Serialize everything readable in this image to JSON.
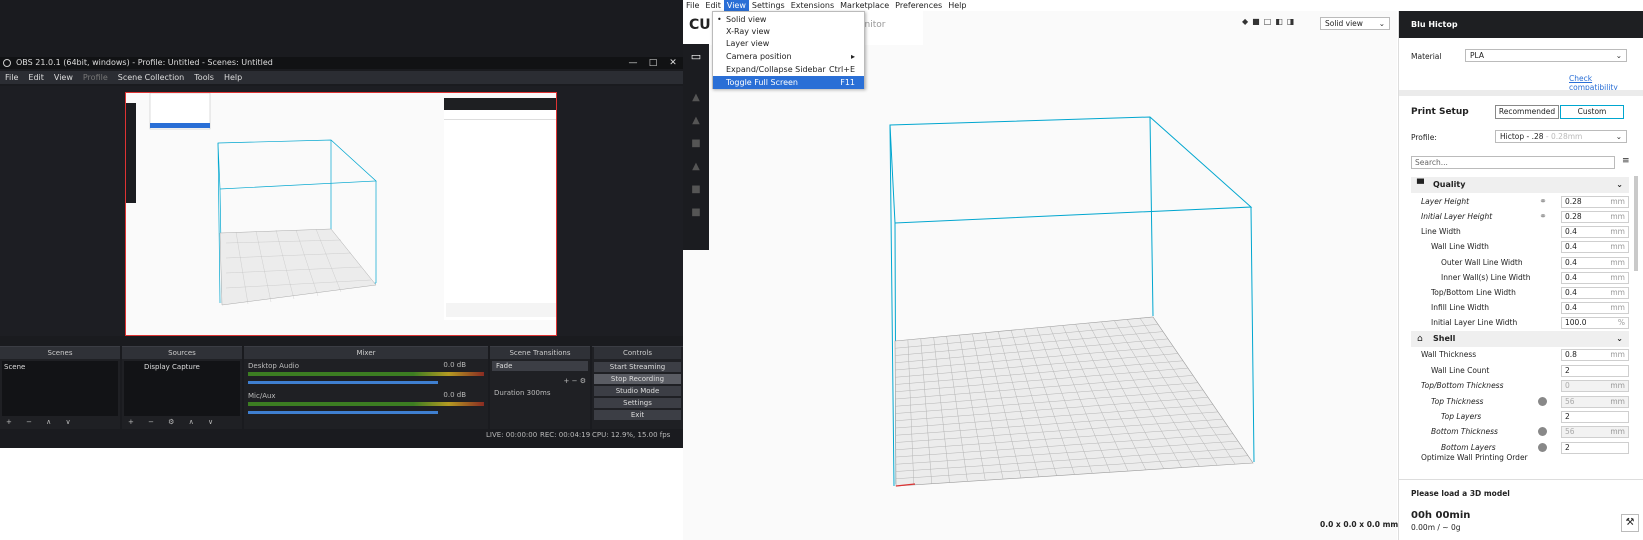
{
  "obs": {
    "title": "OBS 21.0.1 (64bit, windows) - Profile: Untitled - Scenes: Untitled",
    "menu": [
      "File",
      "Edit",
      "View",
      "Profile",
      "Scene Collection",
      "Tools",
      "Help"
    ],
    "docks": {
      "scenes": "Scenes",
      "sources": "Sources",
      "mixer": "Mixer",
      "transitions": "Scene Transitions",
      "controls": "Controls"
    },
    "scene_item": "Scene",
    "source_item": "Display Capture",
    "mixer": [
      {
        "name": "Desktop Audio",
        "level": "0.0 dB"
      },
      {
        "name": "Mic/Aux",
        "level": "0.0 dB"
      }
    ],
    "transition": "Fade",
    "duration_label": "Duration",
    "duration_value": "300ms",
    "controls": [
      "Start Streaming",
      "Stop Recording",
      "Studio Mode",
      "Settings",
      "Exit"
    ],
    "status": {
      "live": "LIVE: 00:00:00",
      "rec": "REC: 00:04:19",
      "cpu": "CPU: 12.9%, 15.00 fps"
    }
  },
  "cura": {
    "menu": [
      "File",
      "Edit",
      "View",
      "Settings",
      "Extensions",
      "Marketplace",
      "Preferences",
      "Help"
    ],
    "logo": "CU",
    "monitor": "onitor",
    "view_mode": "Solid view",
    "dropdown": [
      {
        "label": "Solid view",
        "shortcut": ""
      },
      {
        "label": "X-Ray view",
        "shortcut": ""
      },
      {
        "label": "Layer view",
        "shortcut": ""
      },
      {
        "label": "Camera position",
        "shortcut": "▸"
      },
      {
        "label": "Expand/Collapse Sidebar",
        "shortcut": "Ctrl+E"
      },
      {
        "label": "Toggle Full Screen",
        "shortcut": "F11"
      }
    ],
    "dims": "0.0 x 0.0 x 0.0 mm",
    "side": {
      "printer": "Blu Hictop",
      "material_label": "Material",
      "material": "PLA",
      "check": "Check compatibility",
      "setup": "Print Setup",
      "recommended": "Recommended",
      "custom": "Custom",
      "profile_label": "Profile:",
      "profile": "Hictop - .28",
      "profile_suffix": " - 0.28mm",
      "search": "Search...",
      "quality": "Quality",
      "shell": "Shell",
      "rows": [
        {
          "label": "Layer Height",
          "value": "0.28",
          "unit": "mm",
          "italic": true,
          "link": true
        },
        {
          "label": "Initial Layer Height",
          "value": "0.28",
          "unit": "mm",
          "italic": true,
          "link": true
        },
        {
          "label": "Line Width",
          "value": "0.4",
          "unit": "mm"
        },
        {
          "label": "Wall Line Width",
          "value": "0.4",
          "unit": "mm"
        },
        {
          "label": "Outer Wall Line Width",
          "value": "0.4",
          "unit": "mm"
        },
        {
          "label": "Inner Wall(s) Line Width",
          "value": "0.4",
          "unit": "mm"
        },
        {
          "label": "Top/Bottom Line Width",
          "value": "0.4",
          "unit": "mm"
        },
        {
          "label": "Infill Line Width",
          "value": "0.4",
          "unit": "mm"
        },
        {
          "label": "Initial Layer Line Width",
          "value": "100.0",
          "unit": "%"
        }
      ],
      "shell_rows": [
        {
          "label": "Wall Thickness",
          "value": "0.8",
          "unit": "mm"
        },
        {
          "label": "Wall Line Count",
          "value": "2",
          "unit": ""
        },
        {
          "label": "Top/Bottom Thickness",
          "value": "0",
          "unit": "mm",
          "italic": true
        },
        {
          "label": "Top Thickness",
          "value": "56",
          "unit": "mm",
          "italic": true
        },
        {
          "label": "Top Layers",
          "value": "2",
          "unit": "",
          "italic": true
        },
        {
          "label": "Bottom Thickness",
          "value": "56",
          "unit": "mm",
          "italic": true
        },
        {
          "label": "Bottom Layers",
          "value": "2",
          "unit": "",
          "italic": true
        },
        {
          "label": "Optimize Wall Printing Order",
          "value": "",
          "unit": ""
        }
      ],
      "load": "Please load a 3D model",
      "time": "00h 00min",
      "usage": "0.00m / ~ 0g"
    }
  },
  "colors": {
    "accent": "#2a6fd6",
    "cura_blue": "#00a6cf",
    "dark": "#1e1f22"
  }
}
